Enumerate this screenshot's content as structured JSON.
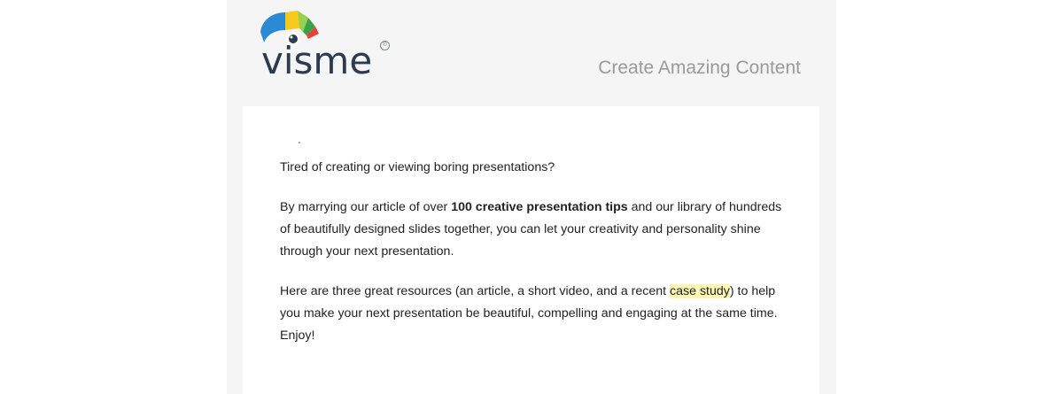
{
  "header": {
    "logo_text": "visme",
    "logo_mark": "®",
    "tagline": "Create Amazing Content"
  },
  "colors": {
    "logo_blue": "#2a8ad4",
    "logo_yellow": "#f6c91c",
    "logo_green": "#7cc243",
    "logo_red": "#e8403a",
    "logo_text": "#2c3b4f",
    "highlight": "#fbf6b2"
  },
  "body": {
    "p1": "Tired of creating or viewing boring presentations?",
    "p2_before": "By marrying our article of over ",
    "p2_bold": "100 creative presentation tips",
    "p2_after": " and our library of hundreds of beautifully designed slides together, you can let your creativity and personality shine through your next presentation.",
    "p3_before": "Here are three great resources (an article, a short video, and a recent ",
    "p3_highlight": "case study",
    "p3_after": ") to help you make your next presentation be beautiful, compelling and engaging at the same time. Enjoy!"
  }
}
